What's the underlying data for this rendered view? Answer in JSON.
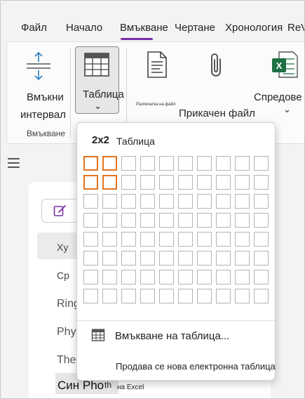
{
  "tabs": [
    "Файл",
    "Начало",
    "Вмъкване",
    "Чертане",
    "Хронология",
    "ReV"
  ],
  "active_tab": "Вмъкване",
  "ribbon": {
    "insert_space": {
      "line1": "Вмъкни",
      "line2": "интервал"
    },
    "table": {
      "label": "Таблица",
      "chevron": "⌄"
    },
    "printout": {
      "tiny": "Разпечатка на файл"
    },
    "attach": {
      "label": "Прикачен файл"
    },
    "spreadsheet": {
      "label": "Спредове",
      "chevron": "⌄"
    },
    "group_label": "Вмъкване"
  },
  "page": {
    "items": [
      "Xy",
      "Ср",
      "Ring",
      "Phy",
      "The",
      "Син Pho"
    ],
    "overlap_text": "на Excel",
    "overlap_th": "th"
  },
  "table_popup": {
    "size_label": "2x2",
    "title": "Таблица",
    "rows": 8,
    "cols": 10,
    "selected_rows": 2,
    "selected_cols": 2,
    "insert_table": "Вмъкване на таблица...",
    "new_spreadsheet": "Продава се нова електронна таблица"
  },
  "colors": {
    "accent": "#7b2fa8",
    "highlight": "#e3731f",
    "excel": "#1d7044"
  }
}
